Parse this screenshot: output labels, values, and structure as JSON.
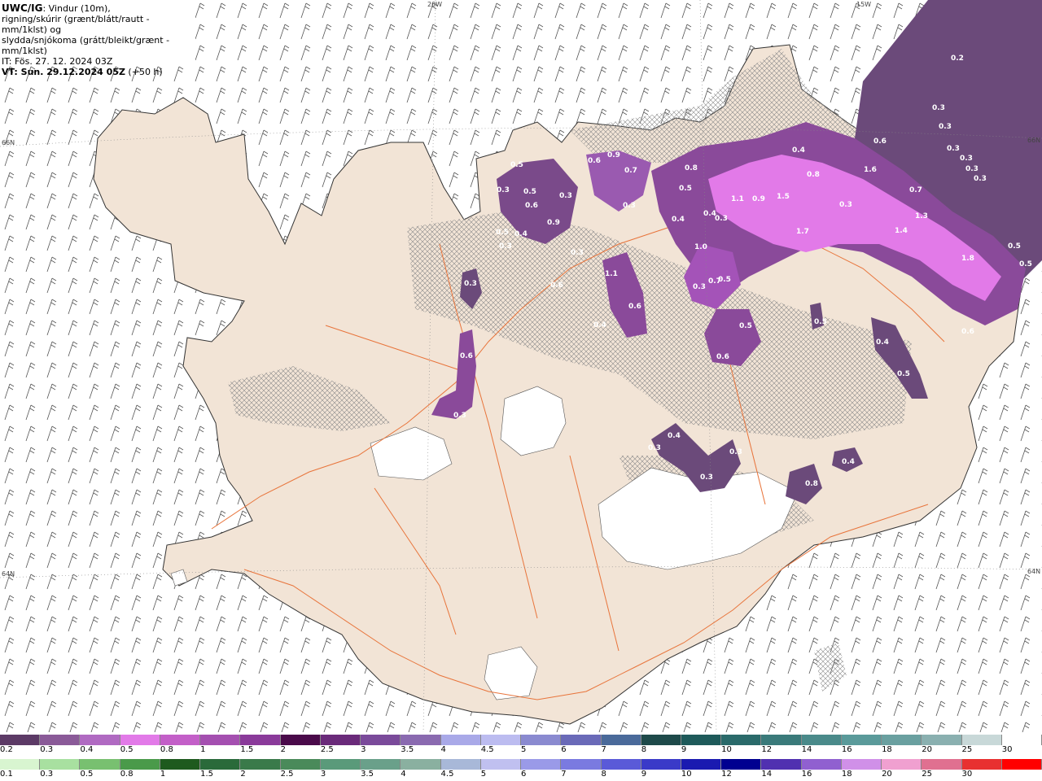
{
  "header": {
    "code": "UWC/IG",
    "line1_rest": ": Vindur (10m),",
    "line2": "rigning/skúrir (grænt/blátt/rautt - mm/1klst) og",
    "line3": "slydda/snjókoma (grátt/bleikt/grænt - mm/1klst)",
    "line4": "IT: Fös. 27. 12. 2024 03Z",
    "line5_vt": "VT: Sun. 29.12.2024 05Z",
    "line5_rest": " (+50 h)"
  },
  "grid_labels": {
    "lon_20w": "20W",
    "lon_15w": "15W",
    "lat_66n_left": "66N",
    "lat_66n_right": "66N",
    "lat_64n_left": "64N",
    "lat_64n_right": "64N"
  },
  "map_colors": {
    "land": "#f2e4d6",
    "sea": "#ffffff",
    "coast": "#333333",
    "roads": "#e8743b",
    "hatch": "#777777",
    "precip_light": "#6b4a7a",
    "precip_mid": "#a453b8",
    "precip_high": "#e27ae8"
  },
  "value_labels": [
    {
      "text": "0.2"
    },
    {
      "text": "0.3"
    },
    {
      "text": "0.3"
    },
    {
      "text": "0.3"
    },
    {
      "text": "0.3"
    },
    {
      "text": "0.3"
    },
    {
      "text": "0.3"
    },
    {
      "text": "0.6"
    },
    {
      "text": "1.6"
    },
    {
      "text": "0.7"
    },
    {
      "text": "1.3"
    },
    {
      "text": "1.4"
    },
    {
      "text": "1.8"
    },
    {
      "text": "0.5"
    },
    {
      "text": "0.5"
    },
    {
      "text": "0.6"
    },
    {
      "text": "0.4"
    },
    {
      "text": "0.5"
    },
    {
      "text": "0.3"
    },
    {
      "text": "1.1"
    },
    {
      "text": "0.9"
    },
    {
      "text": "1.5"
    },
    {
      "text": "1.7"
    },
    {
      "text": "0.4"
    },
    {
      "text": "0.8"
    },
    {
      "text": "0.8"
    },
    {
      "text": "0.5"
    },
    {
      "text": "0.4"
    },
    {
      "text": "0.4"
    },
    {
      "text": "0.3"
    },
    {
      "text": "1.0"
    },
    {
      "text": "0.3"
    },
    {
      "text": "0.7"
    },
    {
      "text": "0.5"
    },
    {
      "text": "0.6"
    },
    {
      "text": "0.6"
    },
    {
      "text": "0.9"
    },
    {
      "text": "0.7"
    },
    {
      "text": "0.3"
    },
    {
      "text": "0.5"
    },
    {
      "text": "0.3"
    },
    {
      "text": "0.5"
    },
    {
      "text": "0.6"
    },
    {
      "text": "0.4"
    },
    {
      "text": "0.9"
    },
    {
      "text": "0.3"
    },
    {
      "text": "0.5"
    },
    {
      "text": "0.3"
    },
    {
      "text": "0.3"
    },
    {
      "text": "1.1"
    },
    {
      "text": "0.6"
    },
    {
      "text": "0.6"
    },
    {
      "text": "0.3"
    },
    {
      "text": "0.3"
    },
    {
      "text": "0.3"
    },
    {
      "text": "0.4"
    },
    {
      "text": "0.3"
    },
    {
      "text": "0.3"
    },
    {
      "text": "0.8"
    },
    {
      "text": "0.4"
    },
    {
      "text": "0.5"
    },
    {
      "text": "0.6"
    },
    {
      "text": "0.4"
    },
    {
      "text": "0.5"
    }
  ],
  "legend": {
    "snow_labels": [
      "0.2",
      "0.3",
      "0.4",
      "0.5",
      "0.8",
      "1",
      "1.5",
      "2",
      "2.5",
      "3",
      "3.5",
      "4",
      "4.5",
      "5",
      "6",
      "7",
      "8",
      "9",
      "10",
      "12",
      "14",
      "16",
      "18",
      "20",
      "25",
      "30"
    ],
    "snow_colors": [
      "#5c3a66",
      "#8a5a98",
      "#b06ac2",
      "#e27ae8",
      "#c35fc8",
      "#a44fb0",
      "#8a3a9a",
      "#4a0a4a",
      "#6a2a7a",
      "#7a4a9a",
      "#8a6ab0",
      "#a9a9e8",
      "#bcbcf0",
      "#8a8ad0",
      "#6a6ab8",
      "#4a6a9a",
      "#1e4a4a",
      "#1e5a5a",
      "#2a6a6a",
      "#3a7a7a",
      "#4a8a8a",
      "#5a9a9a",
      "#6aa0a0",
      "#8ab0b0",
      "#c8d8d8",
      "#ffffff"
    ],
    "rain_labels": [
      "0.1",
      "0.3",
      "0.5",
      "0.8",
      "1",
      "1.5",
      "2",
      "2.5",
      "3",
      "3.5",
      "4",
      "4.5",
      "5",
      "6",
      "7",
      "8",
      "9",
      "10",
      "12",
      "14",
      "16",
      "18",
      "20",
      "25",
      "30"
    ],
    "rain_colors": [
      "#d8f5d0",
      "#a8e0a0",
      "#78c070",
      "#4a9a4a",
      "#1e5a1e",
      "#2a6a3a",
      "#3a7a4a",
      "#4a8a5a",
      "#5a9a7a",
      "#6aa08a",
      "#8ab0a0",
      "#a8b8d8",
      "#c0c0f0",
      "#9a9ae8",
      "#7a7ae0",
      "#5a5ad8",
      "#3a3ac8",
      "#1a1ab0",
      "#000090",
      "#5030b0",
      "#9060d0",
      "#d090e8",
      "#f0a0d0",
      "#e07090",
      "#e83030",
      "#ff0000"
    ]
  }
}
